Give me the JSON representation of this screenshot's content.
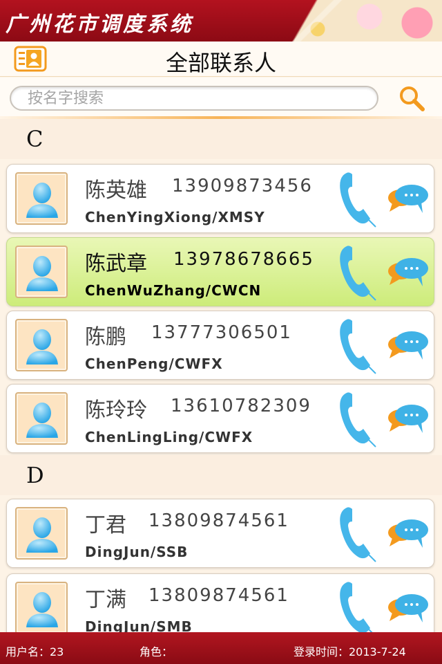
{
  "app": {
    "title": "广州花市调度系统"
  },
  "header": {
    "title": "全部联系人",
    "icon": "contacts-book-icon"
  },
  "search": {
    "placeholder": "按名字搜索",
    "icon": "search-icon"
  },
  "sections": [
    {
      "letter": "C",
      "contacts": [
        {
          "name": "陈英雄",
          "phone": "13909873456",
          "pinyin": "ChenYingXiong/XMSY",
          "selected": false
        },
        {
          "name": "陈武章",
          "phone": "13978678665",
          "pinyin": "ChenWuZhang/CWCN",
          "selected": true
        },
        {
          "name": "陈鹏",
          "phone": "13777306501",
          "pinyin": "ChenPeng/CWFX",
          "selected": false
        },
        {
          "name": "陈玲玲",
          "phone": "13610782309",
          "pinyin": "ChenLingLing/CWFX",
          "selected": false
        }
      ]
    },
    {
      "letter": "D",
      "contacts": [
        {
          "name": "丁君",
          "phone": "13809874561",
          "pinyin": "DingJun/SSB",
          "selected": false
        },
        {
          "name": "丁满",
          "phone": "13809874561",
          "pinyin": "DingJun/SMB",
          "selected": false
        }
      ]
    }
  ],
  "footer": {
    "username": "用户名：23",
    "role": "角色：",
    "login_time": "登录时间：2013-7-24"
  },
  "colors": {
    "brand_red": "#a3101b",
    "selected_green": "#d6ef8e",
    "accent_orange": "#f39a1e",
    "icon_blue": "#3fb2e6"
  }
}
